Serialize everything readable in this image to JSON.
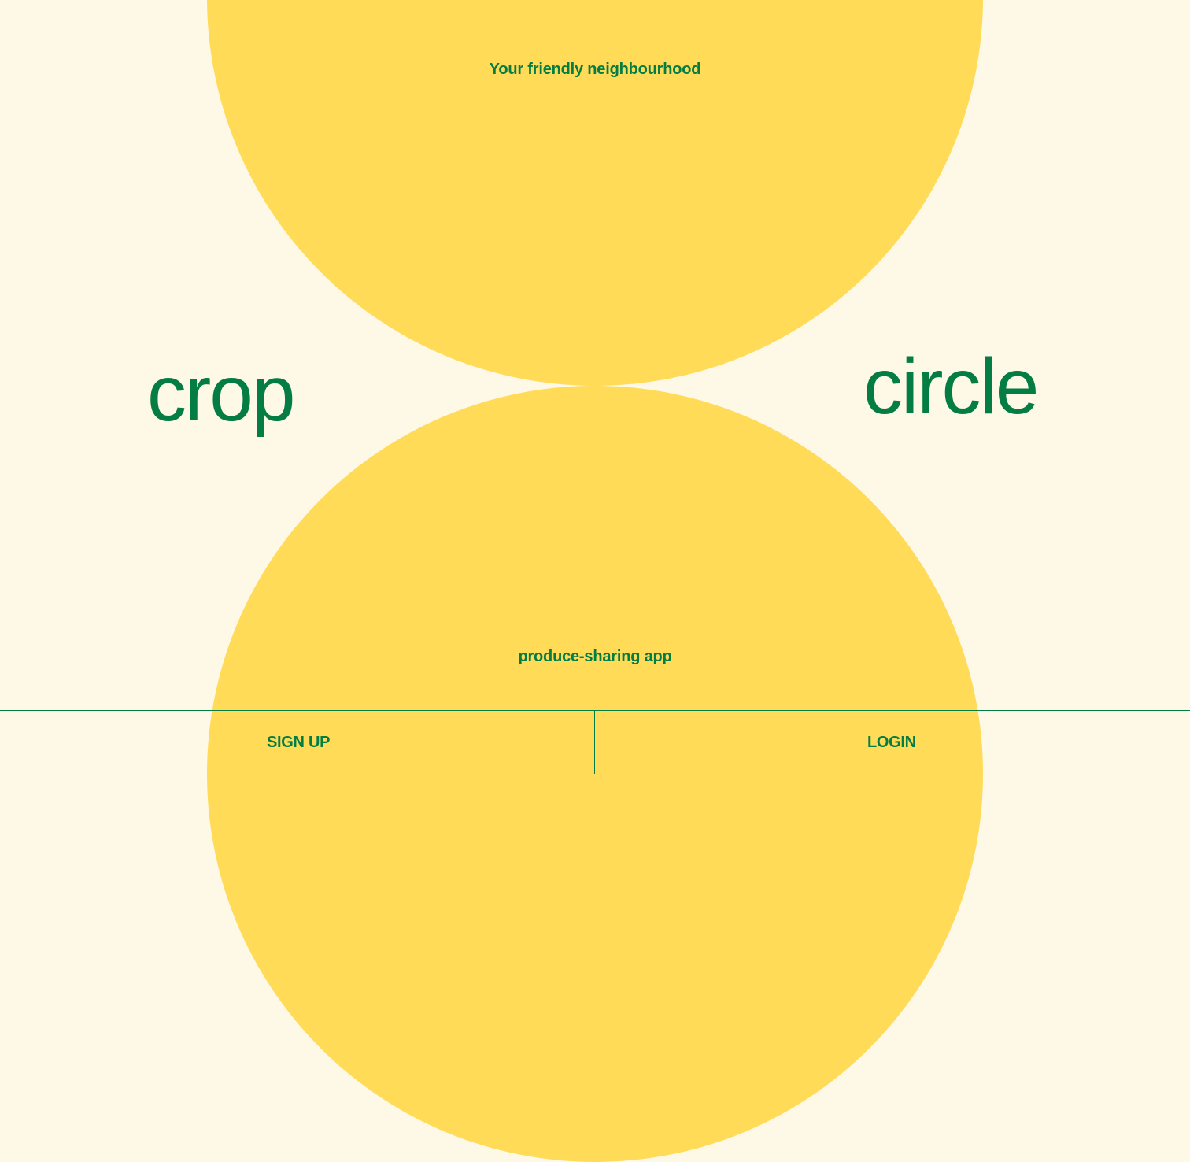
{
  "tagline_top": "Your friendly neighbourhood",
  "brand": {
    "left_word": "crop",
    "right_word": "circle"
  },
  "tagline_bottom": "produce-sharing app",
  "footer": {
    "signup_label": "SIGN UP",
    "login_label": "LOGIN"
  },
  "colors": {
    "background": "#FEF8E6",
    "circle": "#FFDB58",
    "accent_green": "#037D44"
  }
}
